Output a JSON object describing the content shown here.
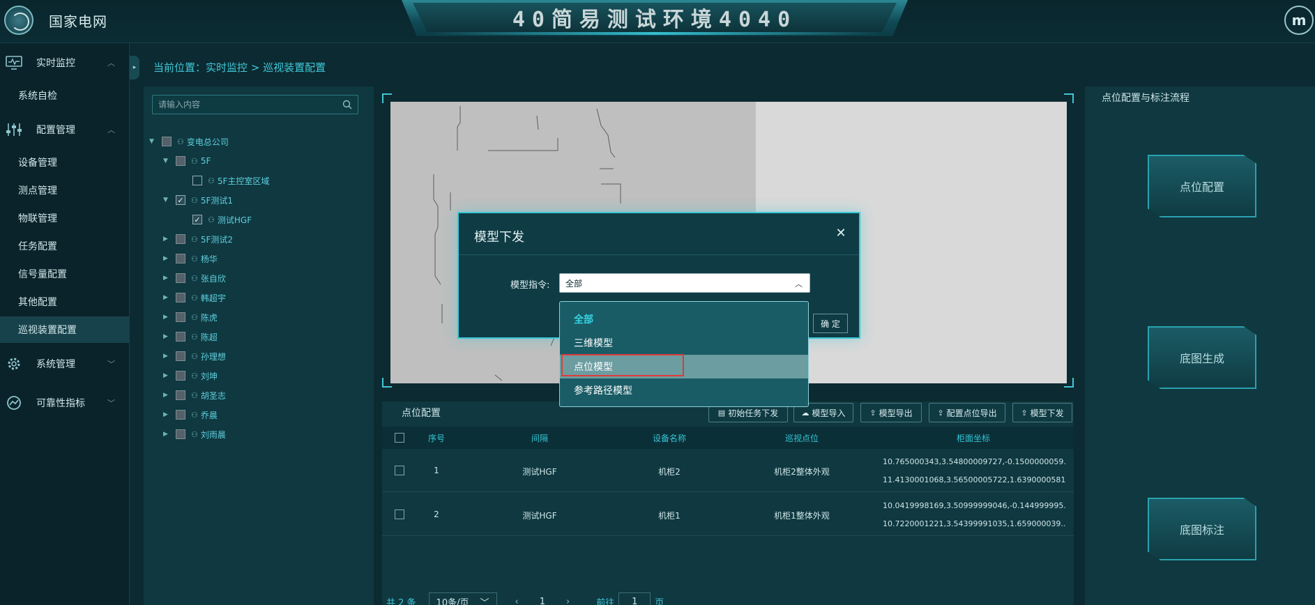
{
  "header": {
    "brand": "国家电网",
    "title": "40简易测试环境4040",
    "avatar_letter": "m"
  },
  "sidebar": {
    "groups": [
      {
        "label": "实时监控",
        "icon": "monitor-icon"
      },
      {
        "label": "配置管理",
        "icon": "sliders-icon"
      },
      {
        "label": "系统管理",
        "icon": "gear-icon"
      },
      {
        "label": "可靠性指标",
        "icon": "reliability-icon"
      }
    ],
    "items": [
      {
        "label": "系统自检"
      },
      {
        "label": "设备管理"
      },
      {
        "label": "测点管理"
      },
      {
        "label": "物联管理"
      },
      {
        "label": "任务配置"
      },
      {
        "label": "信号量配置"
      },
      {
        "label": "其他配置"
      },
      {
        "label": "巡视装置配置",
        "active": true
      }
    ]
  },
  "breadcrumb": "当前位置：实时监控 > 巡视装置配置",
  "tree": {
    "search_placeholder": "请输入内容",
    "nodes": [
      {
        "label": "变电总公司",
        "state": "partial",
        "expanded": true
      },
      {
        "label": "5F",
        "state": "partial",
        "expanded": true
      },
      {
        "label": "5F主控室区域",
        "state": "empty"
      },
      {
        "label": "5F测试1",
        "state": "checked",
        "expanded": true
      },
      {
        "label": "测试HGF",
        "state": "checked"
      },
      {
        "label": "5F测试2",
        "state": "partial"
      },
      {
        "label": "杨华",
        "state": "partial"
      },
      {
        "label": "张自欣",
        "state": "partial"
      },
      {
        "label": "韩超宇",
        "state": "partial"
      },
      {
        "label": "陈虎",
        "state": "partial"
      },
      {
        "label": "陈超",
        "state": "partial"
      },
      {
        "label": "孙理想",
        "state": "partial"
      },
      {
        "label": "刘坤",
        "state": "partial"
      },
      {
        "label": "胡圣志",
        "state": "partial"
      },
      {
        "label": "乔晨",
        "state": "partial"
      },
      {
        "label": "刘雨晨",
        "state": "partial"
      }
    ]
  },
  "table": {
    "title": "点位配置",
    "buttons": [
      "初始任务下发",
      "模型导入",
      "模型导出",
      "配置点位导出",
      "模型下发"
    ],
    "columns": [
      "序号",
      "间隔",
      "设备名称",
      "巡视点位",
      "柜面坐标"
    ],
    "rows": [
      {
        "no": "1",
        "bay": "测试HGF",
        "device": "机柜2",
        "point": "机柜2整体外观",
        "coord1": "10.765000343,3.54800009727,-0.1500000059...",
        "coord2": "11.4130001068,3.56500005722,1.6390000581..."
      },
      {
        "no": "2",
        "bay": "测试HGF",
        "device": "机柜1",
        "point": "机柜1整体外观",
        "coord1": "10.0419998169,3.50999999046,-0.144999995...",
        "coord2": "10.7220001221,3.54399991035,1.659000039..."
      }
    ],
    "pager": {
      "total": "共 2 条",
      "page_size": "10条/页",
      "current": "1",
      "goto_prefix": "前往",
      "goto_value": "1",
      "goto_suffix": "页"
    }
  },
  "right_panel": {
    "title": "点位配置与标注流程",
    "steps": [
      "点位配置",
      "底图生成",
      "底图标注"
    ]
  },
  "modal": {
    "title": "模型下发",
    "field_label": "模型指令:",
    "selected_value": "全部",
    "confirm_label": "确 定",
    "options": [
      {
        "label": "全部",
        "selected": true
      },
      {
        "label": "三维模型"
      },
      {
        "label": "点位模型",
        "hover": true
      },
      {
        "label": "参考路径模型"
      }
    ]
  },
  "colors": {
    "accent": "#39c8d6",
    "background": "#0c2a31",
    "panel": "#0f3840",
    "highlight": "#e03a3a"
  }
}
